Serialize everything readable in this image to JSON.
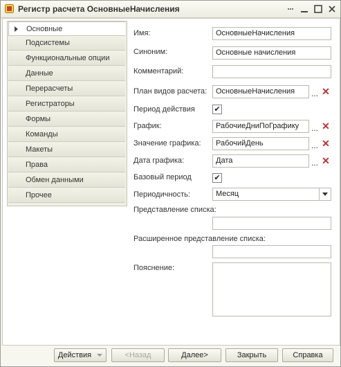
{
  "window": {
    "title": "Регистр расчета ОсновныеНачисления"
  },
  "titlebar_buttons": [
    "min-icon",
    "max-icon",
    "close-icon"
  ],
  "sidebar": {
    "items": [
      {
        "label": "Основные",
        "active": true
      },
      {
        "label": "Подсистемы"
      },
      {
        "label": "Функциональные опции"
      },
      {
        "label": "Данные"
      },
      {
        "label": "Перерасчеты"
      },
      {
        "label": "Регистраторы"
      },
      {
        "label": "Формы"
      },
      {
        "label": "Команды"
      },
      {
        "label": "Макеты"
      },
      {
        "label": "Права"
      },
      {
        "label": "Обмен данными"
      },
      {
        "label": "Прочее"
      }
    ]
  },
  "form": {
    "name": {
      "label": "Имя:",
      "value": "ОсновныеНачисления"
    },
    "synonym": {
      "label": "Синоним:",
      "value": "Основные начисления"
    },
    "comment": {
      "label": "Комментарий:",
      "value": ""
    },
    "calc_plan": {
      "label": "План видов расчета:",
      "value": "ОсновныеНачисления"
    },
    "action_period": {
      "label": "Период действия",
      "checked": true,
      "mark": "✔"
    },
    "schedule": {
      "label": "График:",
      "value": "РабочиеДниПоГрафику"
    },
    "schedule_value": {
      "label": "Значение графика:",
      "value": "РабочийДень"
    },
    "schedule_date": {
      "label": "Дата графика:",
      "value": "Дата"
    },
    "base_period": {
      "label": "Базовый период",
      "checked": true,
      "mark": "✔"
    },
    "periodicity": {
      "label": "Периодичность:",
      "value": "Месяц"
    },
    "list_presentation": {
      "label": "Представление списка:",
      "value": ""
    },
    "ext_list_presentation": {
      "label": "Расширенное представление списка:",
      "value": ""
    },
    "explanation": {
      "label": "Пояснение:",
      "value": ""
    },
    "dots": "...",
    "clear": "✕"
  },
  "footer": {
    "actions": "Действия",
    "back": "<Назад",
    "next": "Далее>",
    "close": "Закрыть",
    "help": "Справка"
  }
}
